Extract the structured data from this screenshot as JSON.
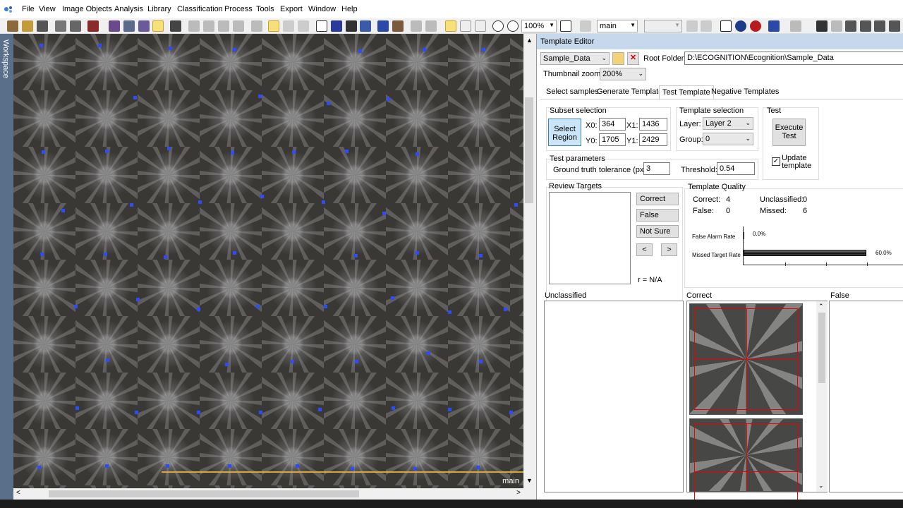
{
  "menu": [
    "File",
    "View",
    "Image Objects",
    "Analysis",
    "Library",
    "Classification",
    "Process",
    "Tools",
    "Export",
    "Window",
    "Help"
  ],
  "toolbar": {
    "zoom": "100%",
    "layer_select": "main"
  },
  "workspace_label": "Workspace",
  "viewer": {
    "label": "main"
  },
  "editor": {
    "title": "Template Editor",
    "template_select": "Sample_Data",
    "root_folder_label": "Root Folder:",
    "root_folder": "D:\\ECOGNITION\\Ecognition\\Sample_Data",
    "thumbnail_zoom_label": "Thumbnail zoom:",
    "thumbnail_zoom": "200%",
    "tabs": [
      "Select samples",
      "Generate Templates",
      "Test Template",
      "Negative Templates"
    ],
    "subset": {
      "title": "Subset selection",
      "button": "Select Region",
      "x0_label": "X0:",
      "x0": "364",
      "x1_label": "X1:",
      "x1": "1436",
      "y0_label": "Y0:",
      "y0": "1705",
      "y1_label": "Y1:",
      "y1": "2429"
    },
    "template_selection": {
      "title": "Template selection",
      "layer_label": "Layer:",
      "layer": "Layer 2",
      "group_label": "Group:",
      "group": "0"
    },
    "test": {
      "title": "Test",
      "execute": "Execute Test",
      "update": "Update template"
    },
    "params": {
      "title": "Test parameters",
      "tolerance_label": "Ground truth tolerance (pxls):",
      "tolerance": "3",
      "threshold_label": "Threshold:",
      "threshold": "0.54"
    },
    "review": {
      "title": "Review Targets",
      "correct": "Correct",
      "false": "False",
      "not_sure": "Not Sure",
      "prev": "<",
      "next": ">",
      "r": "r = N/A"
    },
    "quality": {
      "title": "Template Quality",
      "correct_label": "Correct:",
      "correct": "4",
      "unclassified_label": "Unclassified:",
      "unclassified": "0",
      "false_label": "False:",
      "false": "0",
      "missed_label": "Missed:",
      "missed": "6",
      "far_label": "False Alarm Rate",
      "far_value": "0.0%",
      "far_fraction": 0.0,
      "mtr_label": "Missed Target Rate",
      "mtr_value": "60.0%",
      "mtr_fraction": 0.6
    },
    "lists": {
      "unclassified": "Unclassified",
      "correct": "Correct",
      "false": "False"
    }
  }
}
